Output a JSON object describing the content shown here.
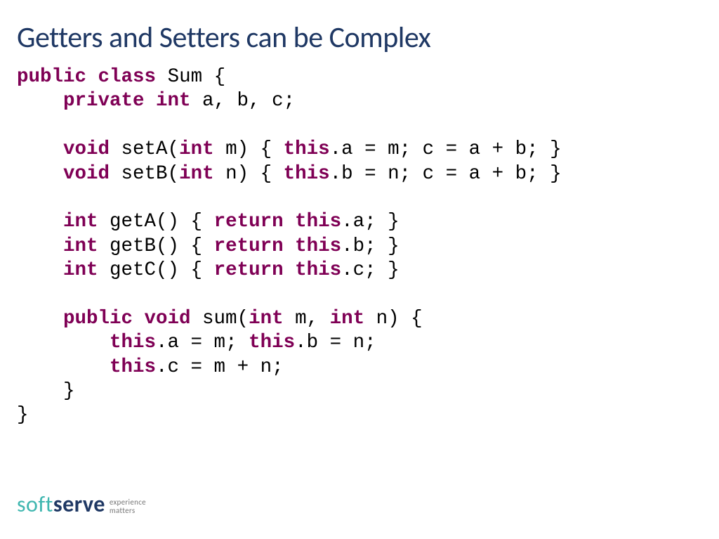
{
  "title": "Getters and Setters can be Complex",
  "code": {
    "l1a": "public",
    "l1b": " class",
    "l1c": " Sum {",
    "l2a": "    private",
    "l2b": " int",
    "l2c": " a, b, c;",
    "blank": "",
    "l3a": "    void",
    "l3b": " setA(",
    "l3c": "int",
    "l3d": " m) { ",
    "l3e": "this",
    "l3f": ".a = m; c = a + b; }",
    "l4a": "    void",
    "l4b": " setB(",
    "l4c": "int",
    "l4d": " n) { ",
    "l4e": "this",
    "l4f": ".b = n; c = a + b; }",
    "l5a": "    int",
    "l5b": " getA() { ",
    "l5c": "return",
    "l5d": " ",
    "l5e": "this",
    "l5f": ".a; }",
    "l6a": "    int",
    "l6b": " getB() { ",
    "l6c": "return",
    "l6d": " ",
    "l6e": "this",
    "l6f": ".b; }",
    "l7a": "    int",
    "l7b": " getC() { ",
    "l7c": "return",
    "l7d": " ",
    "l7e": "this",
    "l7f": ".c; }",
    "l8a": "    public",
    "l8b": " void",
    "l8c": " sum(",
    "l8d": "int",
    "l8e": " m, ",
    "l8f": "int",
    "l8g": " n) {",
    "l9a": "        this",
    "l9b": ".a = m; ",
    "l9c": "this",
    "l9d": ".b = n;",
    "l10a": "        this",
    "l10b": ".c = m + n;",
    "l11": "    }",
    "l12": "}"
  },
  "footer": {
    "soft": "soft",
    "serve": "serve",
    "tag1": "experience",
    "tag2": "matters"
  }
}
